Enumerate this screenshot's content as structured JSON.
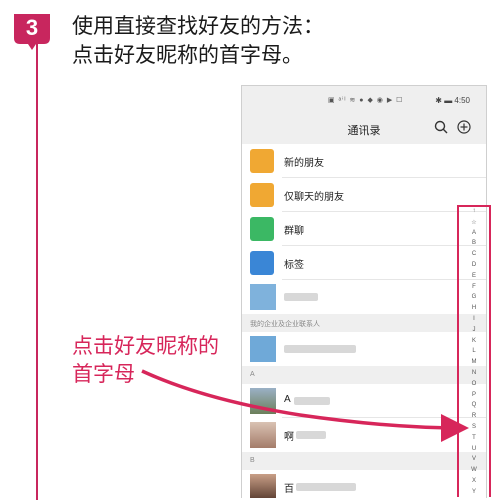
{
  "step": {
    "number": "3",
    "line1": "使用直接查找好友的方法：",
    "line2": "点击好友昵称的首字母。"
  },
  "phone": {
    "status_icons": "▣ ᵃⁱˡ ≋ ● ◆ ◉ ▶ ☐",
    "status_time": "✱ ▬ 4:50",
    "title": "通讯录",
    "rows": [
      {
        "label": "新的朋友",
        "color": "#f0a833"
      },
      {
        "label": "仅聊天的朋友",
        "color": "#f0a833"
      },
      {
        "label": "群聊",
        "color": "#3bb864"
      },
      {
        "label": "标签",
        "color": "#3a86d6"
      }
    ],
    "section_enterprise": "我的企业及企业联系人",
    "section_a": "A",
    "section_b": "B",
    "contact_a1": "A",
    "contact_a2": "啊",
    "contact_b1": "百"
  },
  "index": [
    "↑",
    "☆",
    "A",
    "B",
    "C",
    "D",
    "E",
    "F",
    "G",
    "H",
    "I",
    "J",
    "K",
    "L",
    "M",
    "N",
    "O",
    "P",
    "Q",
    "R",
    "S",
    "T",
    "U",
    "V",
    "W",
    "X",
    "Y"
  ],
  "callout": {
    "line1": "点击好友昵称的",
    "line2": "首字母"
  },
  "colors": {
    "accent": "#d7265a"
  }
}
